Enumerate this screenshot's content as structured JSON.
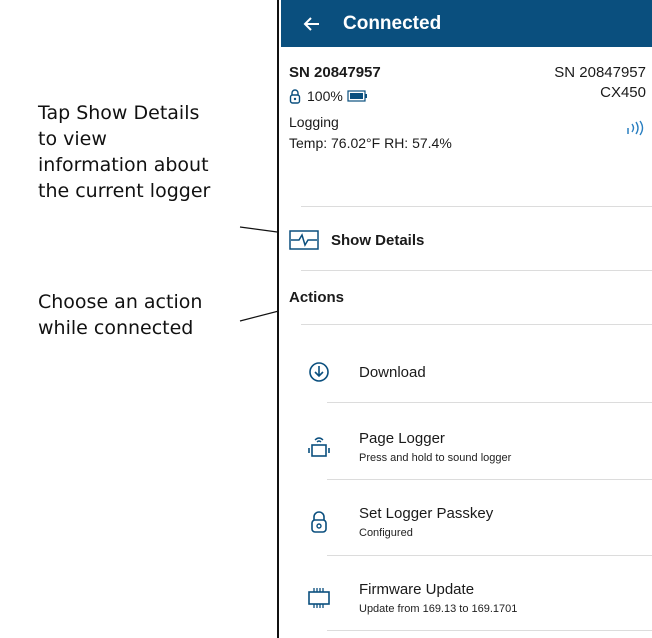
{
  "callouts": {
    "details": "Tap Show Details\nto view\ninformation about\nthe current logger",
    "actions": "Choose an action\nwhile connected"
  },
  "appbar": {
    "back_icon": "arrow-left-icon",
    "title": "Connected",
    "background": "#0a4f7e"
  },
  "logger": {
    "name": "SN 20847957",
    "serial": "SN 20847957",
    "battery": "100%",
    "model": "CX450",
    "state": "Logging",
    "readings": "Temp: 76.02°F RH: 57.4%",
    "signal_icon": "signal-strength-icon"
  },
  "details": {
    "label": "Show Details",
    "icon": "pulse-chart-icon"
  },
  "actions": {
    "header": "Actions",
    "items": [
      {
        "title": "Download",
        "subtitle": "",
        "icon": "download-circle-icon"
      },
      {
        "title": "Page Logger",
        "subtitle": "Press and hold to sound logger",
        "icon": "page-logger-icon"
      },
      {
        "title": "Set Logger Passkey",
        "subtitle": "Configured",
        "icon": "padlock-icon"
      },
      {
        "title": "Firmware Update",
        "subtitle": "Update from 169.13 to 169.1701",
        "icon": "chip-icon"
      }
    ]
  }
}
